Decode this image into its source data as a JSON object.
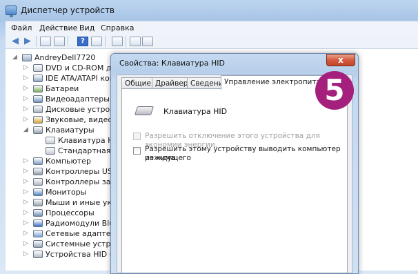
{
  "window": {
    "title": "Диспетчер устройств"
  },
  "menu": [
    "Файл",
    "Действие",
    "Вид",
    "Справка"
  ],
  "toolbar": {
    "help_label": "?"
  },
  "tree": {
    "root": "AndreyDell7720",
    "items": [
      {
        "label": "DVD и CD-ROM диско",
        "expander": "▷"
      },
      {
        "label": "IDE ATA/ATAPI контр",
        "expander": "▷"
      },
      {
        "label": "Батареи",
        "expander": "▷"
      },
      {
        "label": "Видеоадаптеры",
        "expander": "▷"
      },
      {
        "label": "Дисковые устройства",
        "expander": "▷"
      },
      {
        "label": "Звуковые, видео и и",
        "expander": "▷"
      },
      {
        "label": "Клавиатуры",
        "expander": "◢"
      },
      {
        "label": "Клавиатура HID",
        "child": true
      },
      {
        "label": "Стандартная клав",
        "child": true
      },
      {
        "label": "Компьютер",
        "expander": "▷"
      },
      {
        "label": "Контроллеры USB",
        "expander": "▷"
      },
      {
        "label": "Контроллеры запоми",
        "expander": "▷"
      },
      {
        "label": "Мониторы",
        "expander": "▷"
      },
      {
        "label": "Мыши и иные указы",
        "expander": "▷"
      },
      {
        "label": "Процессоры",
        "expander": "▷"
      },
      {
        "label": "Радиомодули Blueto",
        "expander": "▷"
      },
      {
        "label": "Сетевые адаптеры",
        "expander": "▷"
      },
      {
        "label": "Системные устройст",
        "expander": "▷"
      },
      {
        "label": "Устройства HID (Hum",
        "expander": "▷"
      }
    ]
  },
  "dialog": {
    "title": "Свойства: Клавиатура HID",
    "close": "x",
    "tabs": [
      "Общие",
      "Драйвер",
      "Сведения",
      "Управление электропитанием"
    ],
    "device_name": "Клавиатура HID",
    "option1": "Разрешить отключение этого устройства для экономии энергии.",
    "option2_line1": "Разрешить этому устройству выводить компьютер из ждущего",
    "option2_line2": "режима."
  },
  "badge": "5",
  "colors": {
    "badge": "#a51f7c",
    "close": "#c4442a"
  }
}
